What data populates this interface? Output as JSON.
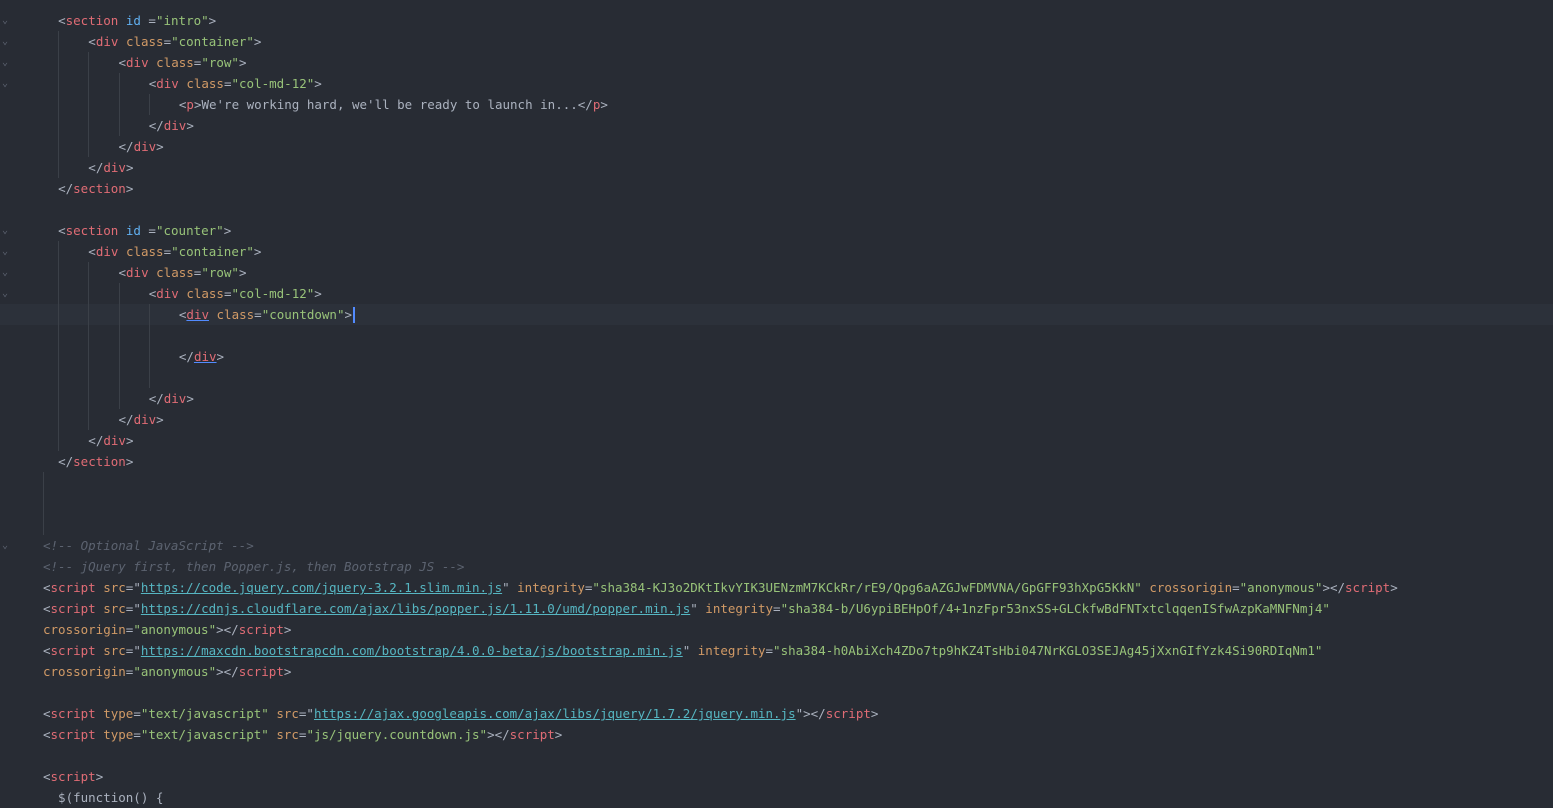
{
  "editor": {
    "theme_colors": {
      "background": "#282c34",
      "tag": "#e06c75",
      "attribute": "#d19a66",
      "id": "#61afef",
      "string": "#98c379",
      "link": "#56b6c2",
      "comment": "#5c6370",
      "cursor": "#528bff"
    },
    "fold_icon": "chevron-down-icon",
    "active_line_index": 14,
    "lines": [
      {
        "fold": true,
        "indent": 2,
        "tokens": [
          [
            "punc",
            "<"
          ],
          [
            "tag",
            "section"
          ],
          [
            "punc",
            " "
          ],
          [
            "id",
            "id"
          ],
          [
            "punc",
            " ="
          ],
          [
            "str",
            "\"intro\""
          ],
          [
            "punc",
            ">"
          ]
        ]
      },
      {
        "fold": true,
        "indent": 6,
        "tokens": [
          [
            "punc",
            "<"
          ],
          [
            "tag",
            "div"
          ],
          [
            "punc",
            " "
          ],
          [
            "attr",
            "class"
          ],
          [
            "punc",
            "="
          ],
          [
            "str",
            "\"container\""
          ],
          [
            "punc",
            ">"
          ]
        ]
      },
      {
        "fold": true,
        "indent": 10,
        "tokens": [
          [
            "punc",
            "<"
          ],
          [
            "tag",
            "div"
          ],
          [
            "punc",
            " "
          ],
          [
            "attr",
            "class"
          ],
          [
            "punc",
            "="
          ],
          [
            "str",
            "\"row\""
          ],
          [
            "punc",
            ">"
          ]
        ]
      },
      {
        "fold": true,
        "indent": 14,
        "tokens": [
          [
            "punc",
            "<"
          ],
          [
            "tag",
            "div"
          ],
          [
            "punc",
            " "
          ],
          [
            "attr",
            "class"
          ],
          [
            "punc",
            "="
          ],
          [
            "str",
            "\"col-md-12\""
          ],
          [
            "punc",
            ">"
          ]
        ]
      },
      {
        "fold": false,
        "indent": 18,
        "tokens": [
          [
            "punc",
            "<"
          ],
          [
            "tag",
            "p"
          ],
          [
            "punc",
            ">"
          ],
          [
            "text",
            "We're working hard, we'll be ready to launch in..."
          ],
          [
            "punc",
            "</"
          ],
          [
            "tag",
            "p"
          ],
          [
            "punc",
            ">"
          ]
        ]
      },
      {
        "fold": false,
        "indent": 14,
        "tokens": [
          [
            "punc",
            "</"
          ],
          [
            "tag",
            "div"
          ],
          [
            "punc",
            ">"
          ]
        ]
      },
      {
        "fold": false,
        "indent": 10,
        "tokens": [
          [
            "punc",
            "</"
          ],
          [
            "tag",
            "div"
          ],
          [
            "punc",
            ">"
          ]
        ]
      },
      {
        "fold": false,
        "indent": 6,
        "tokens": [
          [
            "punc",
            "</"
          ],
          [
            "tag",
            "div"
          ],
          [
            "punc",
            ">"
          ]
        ]
      },
      {
        "fold": false,
        "indent": 2,
        "tokens": [
          [
            "punc",
            "</"
          ],
          [
            "tag",
            "section"
          ],
          [
            "punc",
            ">"
          ]
        ]
      },
      {
        "fold": false,
        "indent": 0,
        "tokens": []
      },
      {
        "fold": true,
        "indent": 2,
        "tokens": [
          [
            "punc",
            "<"
          ],
          [
            "tag",
            "section"
          ],
          [
            "punc",
            " "
          ],
          [
            "id",
            "id"
          ],
          [
            "punc",
            " ="
          ],
          [
            "str",
            "\"counter\""
          ],
          [
            "punc",
            ">"
          ]
        ]
      },
      {
        "fold": true,
        "indent": 6,
        "tokens": [
          [
            "punc",
            "<"
          ],
          [
            "tag",
            "div"
          ],
          [
            "punc",
            " "
          ],
          [
            "attr",
            "class"
          ],
          [
            "punc",
            "="
          ],
          [
            "str",
            "\"container\""
          ],
          [
            "punc",
            ">"
          ]
        ]
      },
      {
        "fold": true,
        "indent": 10,
        "tokens": [
          [
            "punc",
            "<"
          ],
          [
            "tag",
            "div"
          ],
          [
            "punc",
            " "
          ],
          [
            "attr",
            "class"
          ],
          [
            "punc",
            "="
          ],
          [
            "str",
            "\"row\""
          ],
          [
            "punc",
            ">"
          ]
        ]
      },
      {
        "fold": true,
        "indent": 14,
        "tokens": [
          [
            "punc",
            "<"
          ],
          [
            "tag",
            "div"
          ],
          [
            "punc",
            " "
          ],
          [
            "attr",
            "class"
          ],
          [
            "punc",
            "="
          ],
          [
            "str",
            "\"col-md-12\""
          ],
          [
            "punc",
            ">"
          ]
        ]
      },
      {
        "fold": false,
        "indent": 18,
        "tokens": [
          [
            "punc",
            "<"
          ],
          [
            "tag-ul",
            "div"
          ],
          [
            "punc",
            " "
          ],
          [
            "attr",
            "class"
          ],
          [
            "punc",
            "="
          ],
          [
            "str",
            "\"countdown\""
          ],
          [
            "punc",
            ">"
          ]
        ]
      },
      {
        "fold": false,
        "indent": 0,
        "tokens": []
      },
      {
        "fold": false,
        "indent": 18,
        "tokens": [
          [
            "punc",
            "</"
          ],
          [
            "tag-ul",
            "div"
          ],
          [
            "punc",
            ">"
          ]
        ]
      },
      {
        "fold": false,
        "indent": 0,
        "tokens": []
      },
      {
        "fold": false,
        "indent": 14,
        "tokens": [
          [
            "punc",
            "</"
          ],
          [
            "tag",
            "div"
          ],
          [
            "punc",
            ">"
          ]
        ]
      },
      {
        "fold": false,
        "indent": 10,
        "tokens": [
          [
            "punc",
            "</"
          ],
          [
            "tag",
            "div"
          ],
          [
            "punc",
            ">"
          ]
        ]
      },
      {
        "fold": false,
        "indent": 6,
        "tokens": [
          [
            "punc",
            "</"
          ],
          [
            "tag",
            "div"
          ],
          [
            "punc",
            ">"
          ]
        ]
      },
      {
        "fold": false,
        "indent": 2,
        "tokens": [
          [
            "punc",
            "</"
          ],
          [
            "tag",
            "section"
          ],
          [
            "punc",
            ">"
          ]
        ]
      },
      {
        "fold": false,
        "indent": 0,
        "tokens": []
      },
      {
        "fold": false,
        "indent": 0,
        "tokens": []
      },
      {
        "fold": false,
        "indent": 0,
        "tokens": []
      },
      {
        "fold": true,
        "indent": 0,
        "tokens": [
          [
            "comment",
            "<!-- Optional JavaScript -->"
          ]
        ]
      },
      {
        "fold": false,
        "indent": 0,
        "tokens": [
          [
            "comment",
            "<!-- jQuery first, then Popper.js, then Bootstrap JS -->"
          ]
        ]
      },
      {
        "fold": false,
        "indent": 0,
        "tokens": [
          [
            "punc",
            "<"
          ],
          [
            "tag",
            "script"
          ],
          [
            "punc",
            " "
          ],
          [
            "attr",
            "src"
          ],
          [
            "punc",
            "=\""
          ],
          [
            "url",
            "https://code.jquery.com/jquery-3.2.1.slim.min.js"
          ],
          [
            "punc",
            "\" "
          ],
          [
            "attr",
            "integrity"
          ],
          [
            "punc",
            "="
          ],
          [
            "str",
            "\"sha384-KJ3o2DKtIkvYIK3UENzmM7KCkRr/rE9/Qpg6aAZGJwFDMVNA/GpGFF93hXpG5KkN\""
          ],
          [
            "punc",
            " "
          ],
          [
            "attr",
            "crossorigin"
          ],
          [
            "punc",
            "="
          ],
          [
            "str",
            "\"anonymous\""
          ],
          [
            "punc",
            "></"
          ],
          [
            "tag",
            "script"
          ],
          [
            "punc",
            ">"
          ]
        ]
      },
      {
        "fold": false,
        "indent": 0,
        "tokens": [
          [
            "punc",
            "<"
          ],
          [
            "tag",
            "script"
          ],
          [
            "punc",
            " "
          ],
          [
            "attr",
            "src"
          ],
          [
            "punc",
            "=\""
          ],
          [
            "url",
            "https://cdnjs.cloudflare.com/ajax/libs/popper.js/1.11.0/umd/popper.min.js"
          ],
          [
            "punc",
            "\" "
          ],
          [
            "attr",
            "integrity"
          ],
          [
            "punc",
            "="
          ],
          [
            "str",
            "\"sha384-b/U6ypiBEHpOf/4+1nzFpr53nxSS+GLCkfwBdFNTxtclqqenISfwAzpKaMNFNmj4\""
          ]
        ]
      },
      {
        "fold": false,
        "indent": 0,
        "tokens": [
          [
            "attr",
            "crossorigin"
          ],
          [
            "punc",
            "="
          ],
          [
            "str",
            "\"anonymous\""
          ],
          [
            "punc",
            "></"
          ],
          [
            "tag",
            "script"
          ],
          [
            "punc",
            ">"
          ]
        ]
      },
      {
        "fold": false,
        "indent": 0,
        "tokens": [
          [
            "punc",
            "<"
          ],
          [
            "tag",
            "script"
          ],
          [
            "punc",
            " "
          ],
          [
            "attr",
            "src"
          ],
          [
            "punc",
            "=\""
          ],
          [
            "url",
            "https://maxcdn.bootstrapcdn.com/bootstrap/4.0.0-beta/js/bootstrap.min.js"
          ],
          [
            "punc",
            "\" "
          ],
          [
            "attr",
            "integrity"
          ],
          [
            "punc",
            "="
          ],
          [
            "str",
            "\"sha384-h0AbiXch4ZDo7tp9hKZ4TsHbi047NrKGLO3SEJAg45jXxnGIfYzk4Si90RDIqNm1\""
          ]
        ]
      },
      {
        "fold": false,
        "indent": 0,
        "tokens": [
          [
            "attr",
            "crossorigin"
          ],
          [
            "punc",
            "="
          ],
          [
            "str",
            "\"anonymous\""
          ],
          [
            "punc",
            "></"
          ],
          [
            "tag",
            "script"
          ],
          [
            "punc",
            ">"
          ]
        ]
      },
      {
        "fold": false,
        "indent": 0,
        "tokens": []
      },
      {
        "fold": false,
        "indent": 0,
        "tokens": [
          [
            "punc",
            "<"
          ],
          [
            "tag",
            "script"
          ],
          [
            "punc",
            " "
          ],
          [
            "attr",
            "type"
          ],
          [
            "punc",
            "="
          ],
          [
            "str",
            "\"text/javascript\""
          ],
          [
            "punc",
            " "
          ],
          [
            "attr",
            "src"
          ],
          [
            "punc",
            "=\""
          ],
          [
            "url",
            "https://ajax.googleapis.com/ajax/libs/jquery/1.7.2/jquery.min.js"
          ],
          [
            "punc",
            "\"></"
          ],
          [
            "tag",
            "script"
          ],
          [
            "punc",
            ">"
          ]
        ]
      },
      {
        "fold": false,
        "indent": 0,
        "tokens": [
          [
            "punc",
            "<"
          ],
          [
            "tag",
            "script"
          ],
          [
            "punc",
            " "
          ],
          [
            "attr",
            "type"
          ],
          [
            "punc",
            "="
          ],
          [
            "str",
            "\"text/javascript\""
          ],
          [
            "punc",
            " "
          ],
          [
            "attr",
            "src"
          ],
          [
            "punc",
            "="
          ],
          [
            "str",
            "\"js/jquery.countdown.js\""
          ],
          [
            "punc",
            "></"
          ],
          [
            "tag",
            "script"
          ],
          [
            "punc",
            ">"
          ]
        ]
      },
      {
        "fold": false,
        "indent": 0,
        "tokens": []
      },
      {
        "fold": false,
        "indent": 0,
        "tokens": [
          [
            "punc",
            "<"
          ],
          [
            "tag",
            "script"
          ],
          [
            "punc",
            ">"
          ]
        ]
      },
      {
        "fold": false,
        "indent": 0,
        "tokens": [
          [
            "text",
            "  $(function() {"
          ]
        ]
      }
    ]
  }
}
